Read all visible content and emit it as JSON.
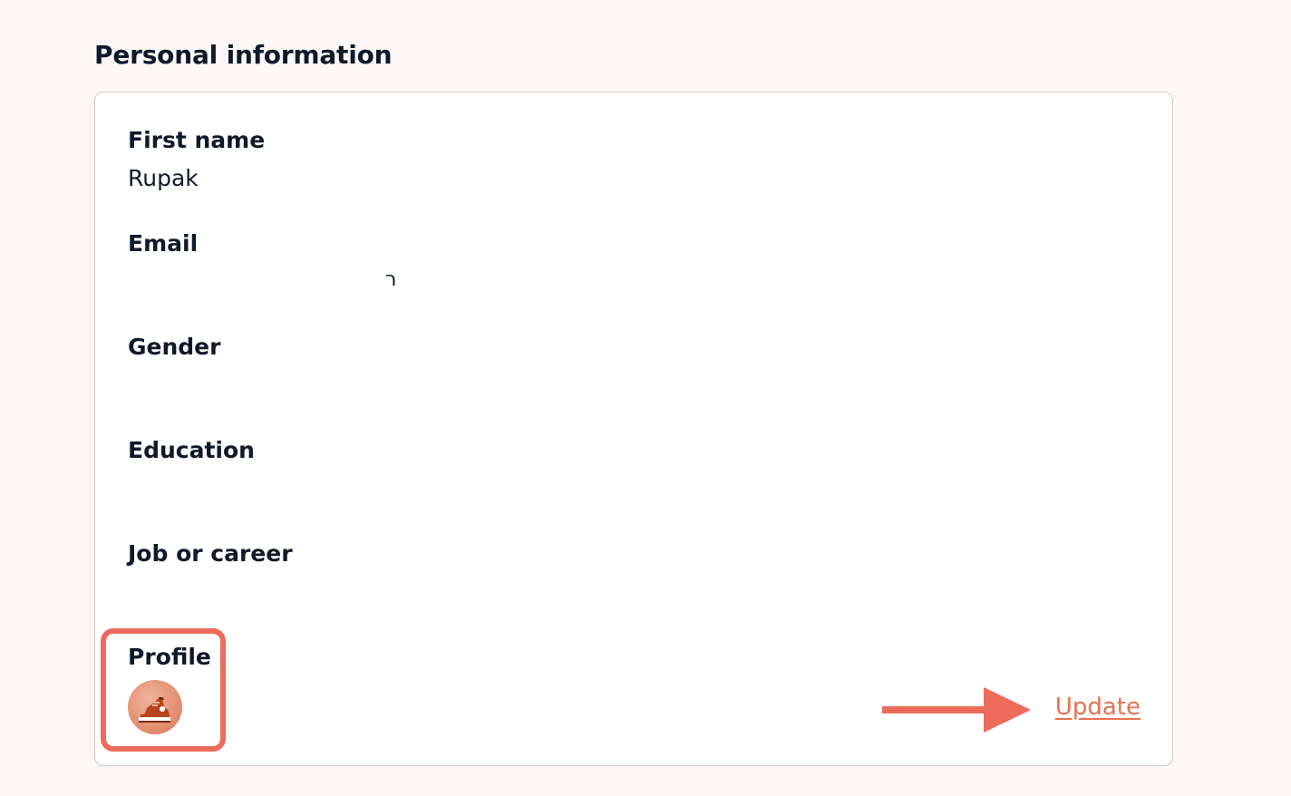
{
  "section": {
    "title": "Personal information"
  },
  "fields": {
    "first_name": {
      "label": "First name",
      "value": "Rupak"
    },
    "email": {
      "label": "Email",
      "value": "ר"
    },
    "gender": {
      "label": "Gender",
      "value": ""
    },
    "education": {
      "label": "Education",
      "value": ""
    },
    "job": {
      "label": "Job or career",
      "value": ""
    },
    "profile": {
      "label": "Profile",
      "avatar_icon": "sneaker-icon"
    }
  },
  "actions": {
    "update_label": "Update"
  },
  "colors": {
    "accent": "#e8714f",
    "highlight": "#ee6b5b",
    "background": "#fdf8f5",
    "text": "#0e1a2b"
  }
}
